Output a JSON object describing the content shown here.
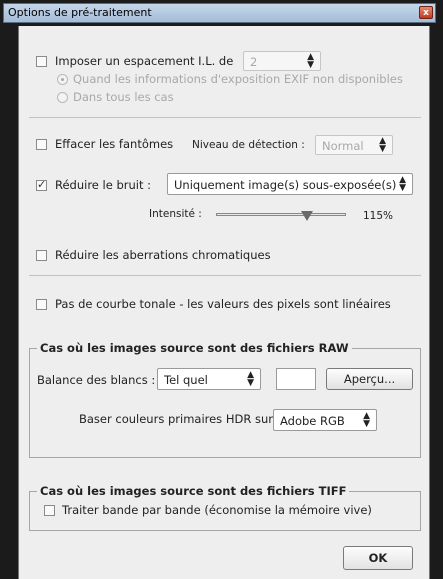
{
  "window": {
    "title": "Options de pré-traitement",
    "close_glyph": "x"
  },
  "spacing": {
    "label": "Imposer un espacement I.L. de",
    "value": "2",
    "checked": false,
    "radio1": "Quand les informations d'exposition EXIF non disponibles",
    "radio2": "Dans tous les cas"
  },
  "ghosts": {
    "label": "Effacer les fantômes",
    "detect_label": "Niveau de détection :",
    "detect_value": "Normal",
    "checked": false
  },
  "noise": {
    "label": "Réduire le bruit :",
    "value": "Uniquement image(s) sous-exposée(s)",
    "checked": true,
    "intensity_label": "Intensité :",
    "intensity_value": "115%",
    "intensity_level": 0.7
  },
  "chromatic": {
    "label": "Réduire les aberrations chromatiques",
    "checked": false
  },
  "linear": {
    "label": "Pas de courbe tonale - les valeurs des pixels sont linéaires",
    "checked": false
  },
  "raw": {
    "title": "Cas où les images source sont des fichiers RAW",
    "wb_label": "Balance des blancs :",
    "wb_value": "Tel quel",
    "preview_button": "Aperçu...",
    "primaries_label": "Baser couleurs primaires HDR sur :",
    "primaries_value": "Adobe RGB"
  },
  "tiff": {
    "title": "Cas où les images source sont des fichiers TIFF",
    "band_label": "Traiter bande par bande (économise la mémoire vive)",
    "checked": false
  },
  "ok_button": "OK",
  "icons": {
    "select_arrows": "up-down-arrows-icon"
  }
}
